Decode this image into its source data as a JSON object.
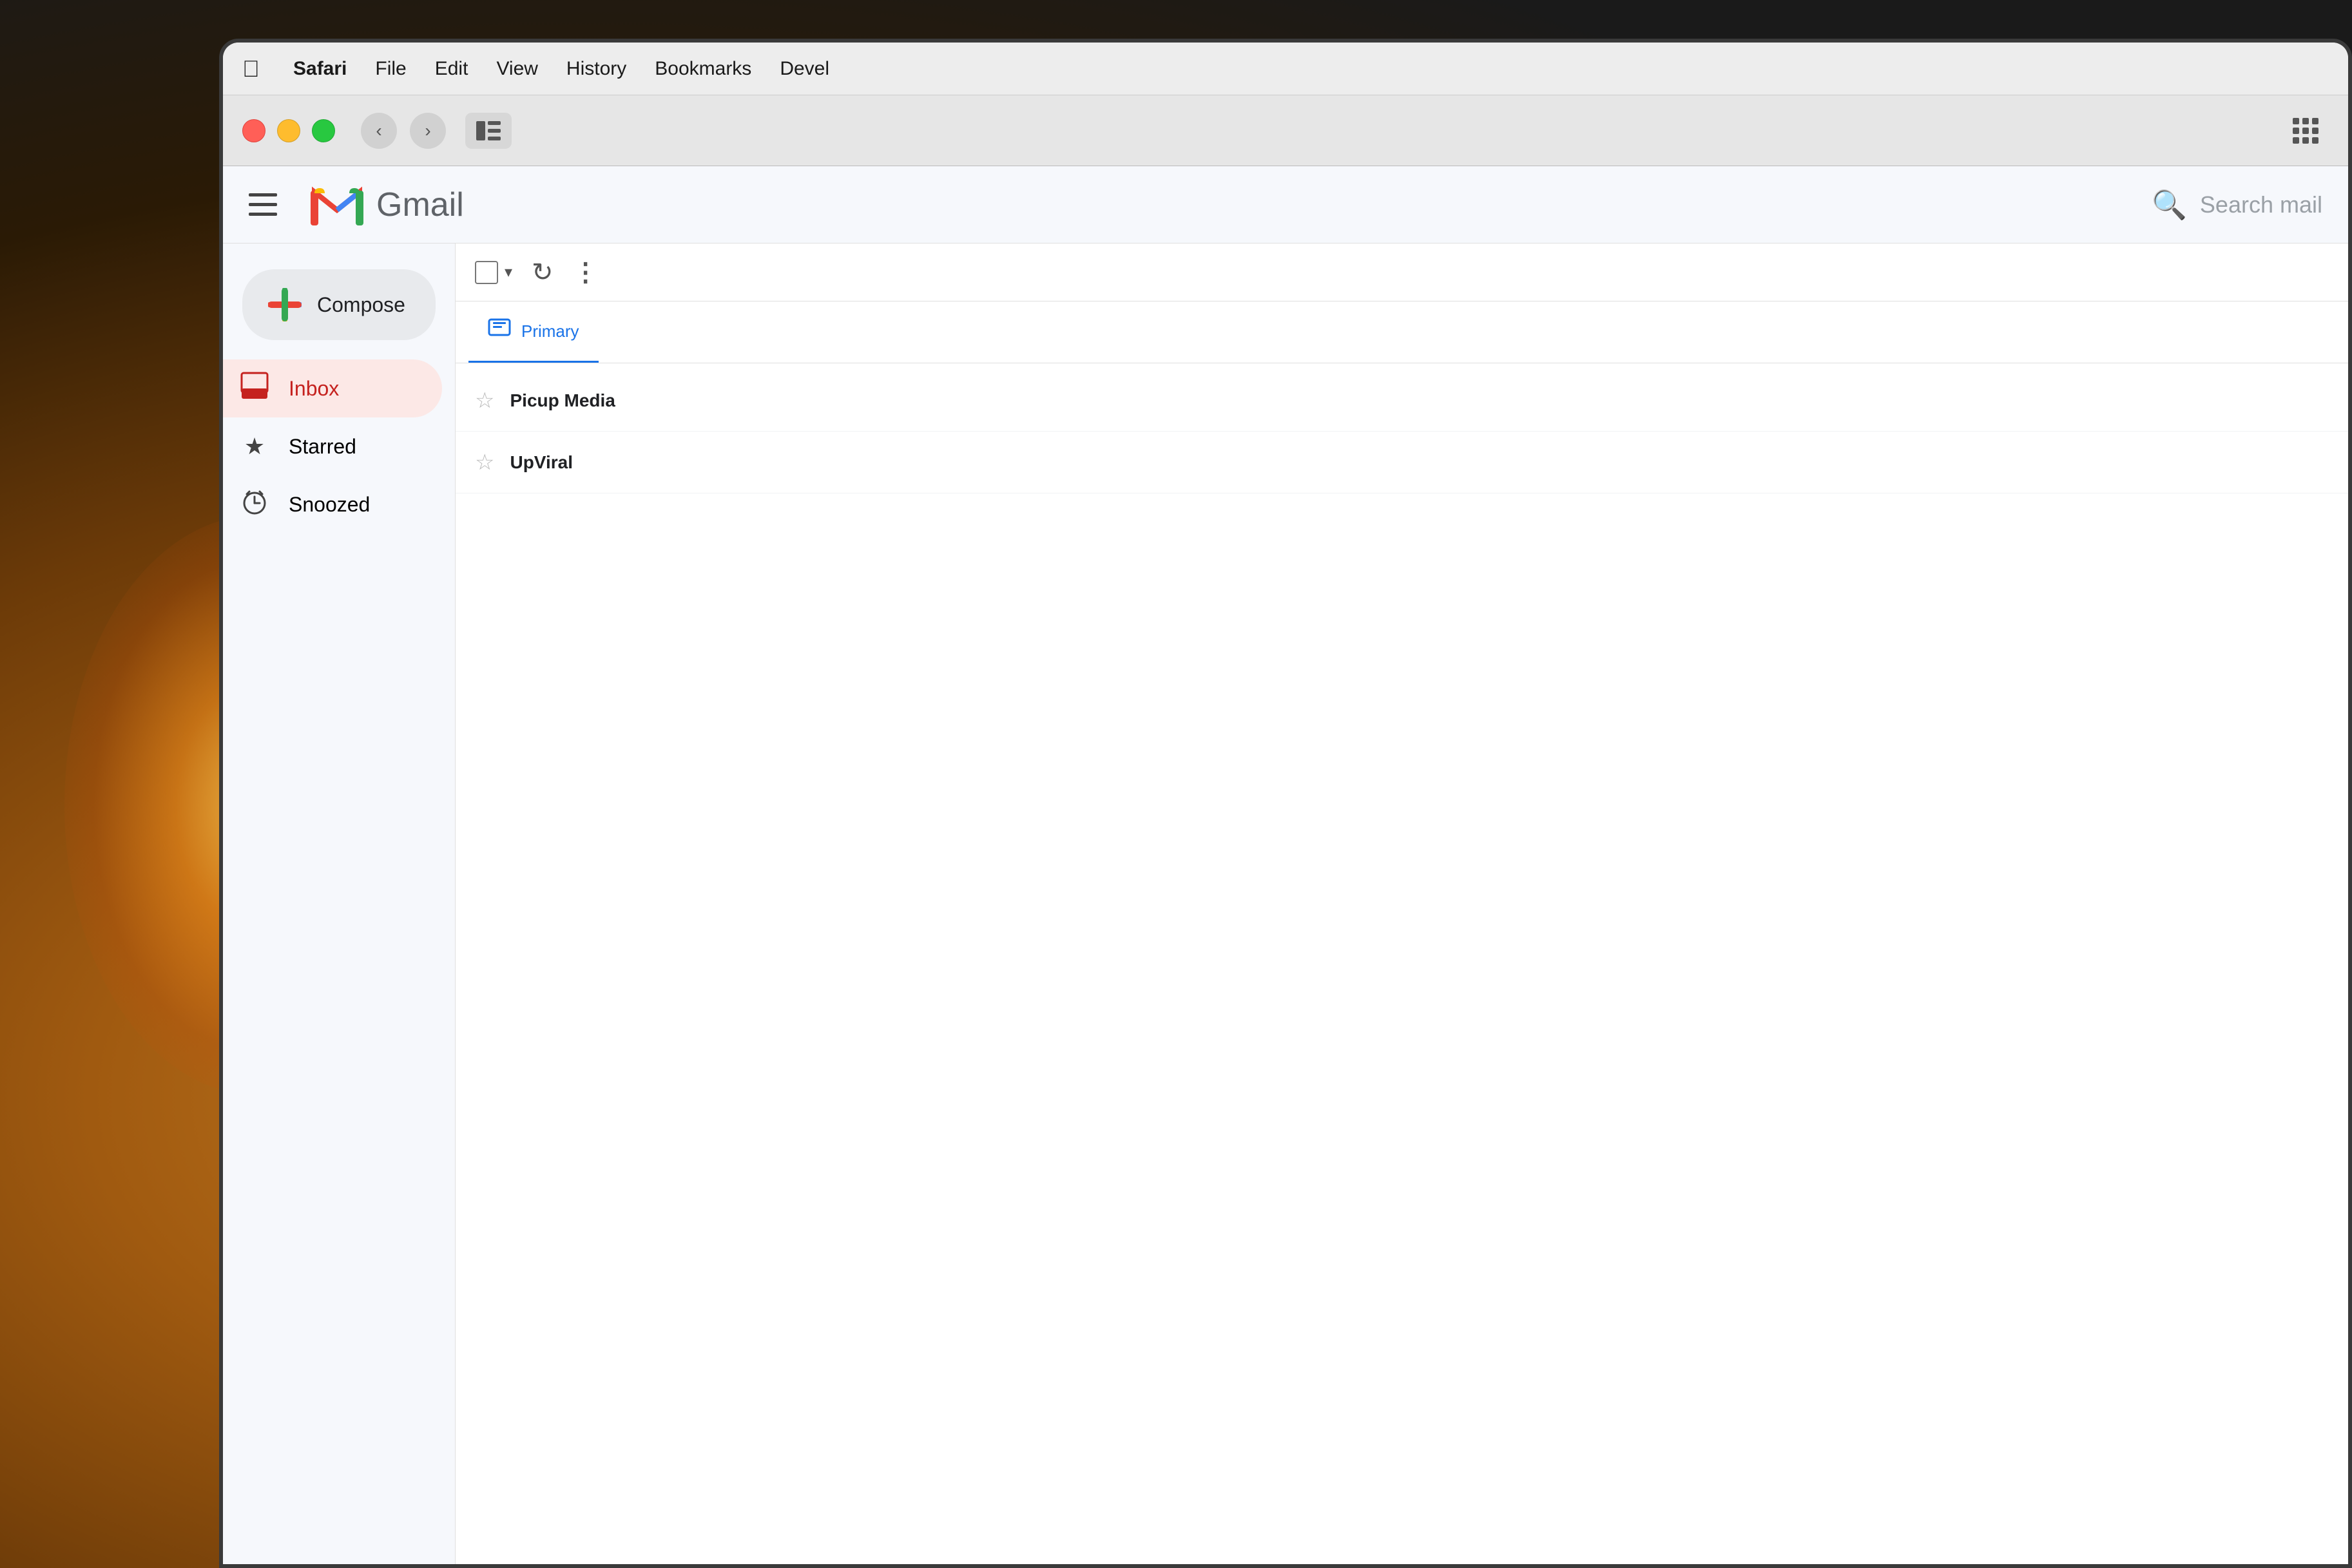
{
  "background": {
    "description": "Dark warm background with bokeh light effect"
  },
  "menubar": {
    "apple_label": "",
    "items": [
      {
        "id": "safari",
        "label": "Safari",
        "bold": true
      },
      {
        "id": "file",
        "label": "File",
        "bold": false
      },
      {
        "id": "edit",
        "label": "Edit",
        "bold": false
      },
      {
        "id": "view",
        "label": "View",
        "bold": false
      },
      {
        "id": "history",
        "label": "History",
        "bold": false
      },
      {
        "id": "bookmarks",
        "label": "Bookmarks",
        "bold": false
      },
      {
        "id": "develop",
        "label": "Devel",
        "bold": false
      }
    ]
  },
  "safari_toolbar": {
    "back_label": "‹",
    "forward_label": "›",
    "sidebar_label": "⊞"
  },
  "gmail": {
    "header": {
      "logo_text": "Gmail",
      "search_placeholder": "Search mail"
    },
    "compose": {
      "label": "Compose"
    },
    "nav": [
      {
        "id": "inbox",
        "label": "Inbox",
        "active": true,
        "icon": "inbox"
      },
      {
        "id": "starred",
        "label": "Starred",
        "active": false,
        "icon": "star"
      },
      {
        "id": "snoozed",
        "label": "Snoozed",
        "active": false,
        "icon": "clock"
      }
    ],
    "email_toolbar": {
      "refresh_label": "↻",
      "more_label": "⋮"
    },
    "tabs": [
      {
        "id": "primary",
        "label": "Primary",
        "active": true
      }
    ],
    "emails": [
      {
        "id": "email-1",
        "sender": "Picup Media",
        "starred": false
      },
      {
        "id": "email-2",
        "sender": "UpViral",
        "starred": false
      }
    ]
  }
}
